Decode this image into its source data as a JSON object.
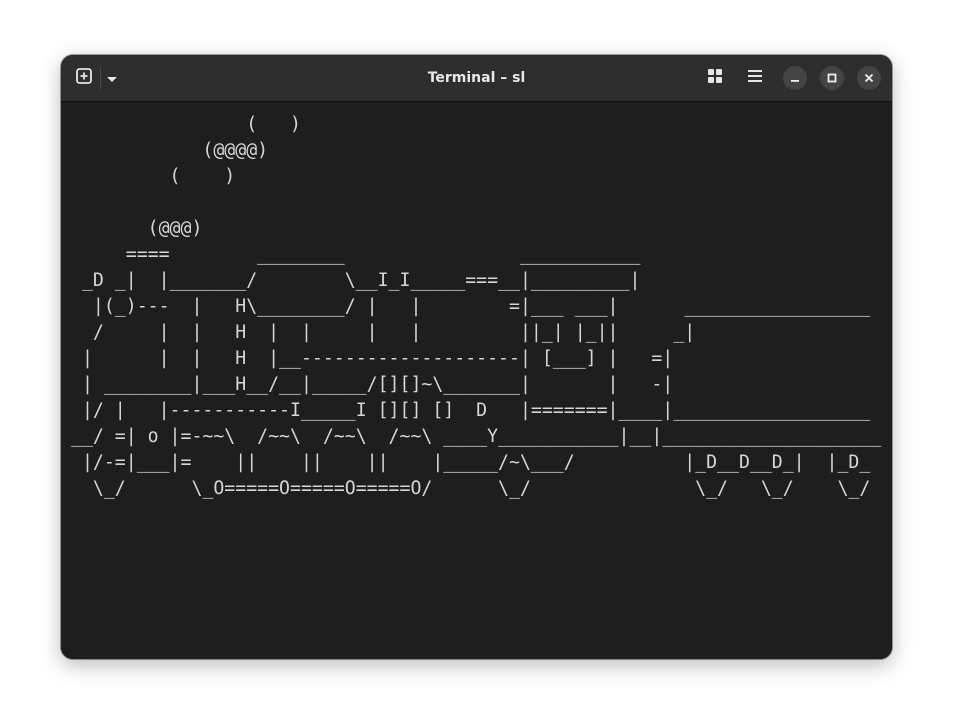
{
  "window": {
    "title": "Terminal – sl"
  },
  "headerbar": {
    "new_tab_icon": "new-tab-icon",
    "tab_menu_icon": "chevron-down-icon",
    "overview_icon": "grid-icon",
    "main_menu_icon": "hamburger-menu-icon",
    "minimize_icon": "minimize-icon",
    "maximize_icon": "maximize-icon",
    "close_icon": "close-icon"
  },
  "terminal": {
    "lines": [
      "                (   )",
      "            (@@@@)",
      "         (    )",
      "",
      "       (@@@)",
      "     ====        ________                ___________",
      " _D _|  |_______/        \\__I_I_____===__|_________|",
      "  |(_)---  |   H\\________/ |   |        =|___ ___|      _________________",
      "  /     |  |   H  |  |     |   |         ||_| |_||     _|",
      " |      |  |   H  |__--------------------| [___] |   =|",
      " | ________|___H__/__|_____/[][]~\\_______|       |   -|",
      " |/ |   |-----------I_____I [][] []  D   |=======|____|__________________",
      "__/ =| o |=-~~\\  /~~\\  /~~\\  /~~\\ ____Y___________|__|____________________",
      " |/-=|___|=    ||    ||    ||    |_____/~\\___/          |_D__D__D_|  |_D_",
      "  \\_/      \\_O=====O=====O=====O/      \\_/               \\_/   \\_/    \\_/"
    ]
  }
}
